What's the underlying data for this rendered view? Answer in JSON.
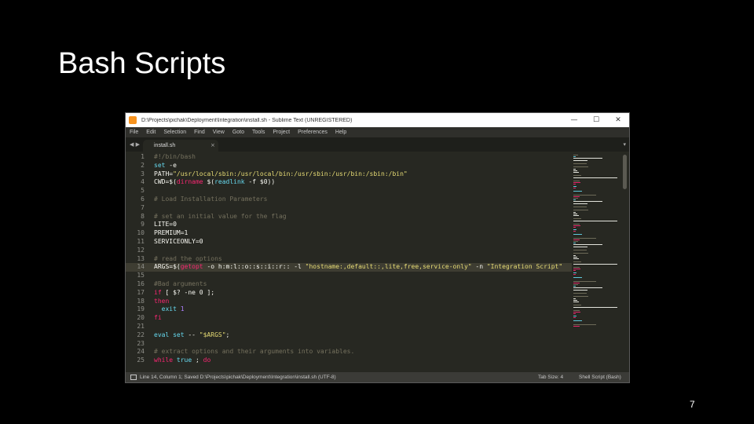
{
  "slide": {
    "title": "Bash Scripts",
    "page_number": "7"
  },
  "window": {
    "title": "D:\\Projects\\pichak\\Deployment\\Integration\\install.sh - Sublime Text (UNREGISTERED)",
    "buttons": [
      "—",
      "☐",
      "✕"
    ]
  },
  "menu": [
    "File",
    "Edit",
    "Selection",
    "Find",
    "View",
    "Goto",
    "Tools",
    "Project",
    "Preferences",
    "Help"
  ],
  "tabs": {
    "nav": "◀ ▶",
    "active_label": "install.sh",
    "close": "×",
    "dropdown": "▾"
  },
  "editor": {
    "highlighted_line": 14,
    "lines": [
      {
        "n": "1",
        "segments": [
          {
            "t": "#!/bin/bash",
            "c": "#75715e"
          }
        ]
      },
      {
        "n": "2",
        "segments": [
          {
            "t": "set",
            "c": "#66d9ef"
          },
          {
            "t": " -e",
            "c": "#f8f8f2"
          }
        ]
      },
      {
        "n": "3",
        "segments": [
          {
            "t": "PATH=",
            "c": "#f8f8f2"
          },
          {
            "t": "\"/usr/local/sbin:/usr/local/bin:/usr/sbin:/usr/bin:/sbin:/bin\"",
            "c": "#e6db74"
          }
        ]
      },
      {
        "n": "4",
        "segments": [
          {
            "t": "CWD=$(",
            "c": "#f8f8f2"
          },
          {
            "t": "dirname",
            "c": "#f92672"
          },
          {
            "t": " $(",
            "c": "#f8f8f2"
          },
          {
            "t": "readlink",
            "c": "#66d9ef"
          },
          {
            "t": " -f $0))",
            "c": "#f8f8f2"
          }
        ]
      },
      {
        "n": "5",
        "segments": []
      },
      {
        "n": "6",
        "segments": [
          {
            "t": "# Load Installation Parameters",
            "c": "#75715e"
          }
        ]
      },
      {
        "n": "7",
        "segments": []
      },
      {
        "n": "8",
        "segments": [
          {
            "t": "# set an initial value for the flag",
            "c": "#75715e"
          }
        ]
      },
      {
        "n": "9",
        "segments": [
          {
            "t": "LITE=0",
            "c": "#f8f8f2"
          }
        ]
      },
      {
        "n": "10",
        "segments": [
          {
            "t": "PREMIUM=1",
            "c": "#f8f8f2"
          }
        ]
      },
      {
        "n": "11",
        "segments": [
          {
            "t": "SERVICEONLY=0",
            "c": "#f8f8f2"
          }
        ]
      },
      {
        "n": "12",
        "segments": []
      },
      {
        "n": "13",
        "segments": [
          {
            "t": "# read the options",
            "c": "#75715e"
          }
        ]
      },
      {
        "n": "14",
        "segments": [
          {
            "t": "ARGS=$(",
            "c": "#f8f8f2"
          },
          {
            "t": "getopt",
            "c": "#f92672"
          },
          {
            "t": " -o h:m:l::o::s::i::r:: -l ",
            "c": "#f8f8f2"
          },
          {
            "t": "\"hostname:,default::,lite,free,service-only\"",
            "c": "#e6db74"
          },
          {
            "t": " -n ",
            "c": "#f8f8f2"
          },
          {
            "t": "\"Integration Script\"",
            "c": "#e6db74"
          }
        ]
      },
      {
        "n": "15",
        "segments": []
      },
      {
        "n": "16",
        "segments": [
          {
            "t": "#Bad arguments",
            "c": "#75715e"
          }
        ]
      },
      {
        "n": "17",
        "segments": [
          {
            "t": "if",
            "c": "#f92672"
          },
          {
            "t": " [ $? -ne 0 ];",
            "c": "#f8f8f2"
          }
        ]
      },
      {
        "n": "18",
        "segments": [
          {
            "t": "then",
            "c": "#f92672"
          }
        ]
      },
      {
        "n": "19",
        "segments": [
          {
            "t": "  exit",
            "c": "#66d9ef"
          },
          {
            "t": " 1",
            "c": "#ae81ff"
          }
        ]
      },
      {
        "n": "20",
        "segments": [
          {
            "t": "fi",
            "c": "#f92672"
          }
        ]
      },
      {
        "n": "21",
        "segments": []
      },
      {
        "n": "22",
        "segments": [
          {
            "t": "eval",
            "c": "#66d9ef"
          },
          {
            "t": " set",
            "c": "#66d9ef"
          },
          {
            "t": " -- ",
            "c": "#f8f8f2"
          },
          {
            "t": "\"$ARGS\"",
            "c": "#e6db74"
          },
          {
            "t": ";",
            "c": "#f8f8f2"
          }
        ]
      },
      {
        "n": "23",
        "segments": []
      },
      {
        "n": "24",
        "segments": [
          {
            "t": "# extract options and their arguments into variables.",
            "c": "#75715e"
          }
        ]
      },
      {
        "n": "25",
        "segments": [
          {
            "t": "while",
            "c": "#f92672"
          },
          {
            "t": " true",
            "c": "#66d9ef"
          },
          {
            "t": " ; ",
            "c": "#f8f8f2"
          },
          {
            "t": "do",
            "c": "#f92672"
          }
        ]
      }
    ]
  },
  "status": {
    "left": "Line 14, Column 1; Saved D:\\Projects\\pichak\\Deployment\\Integration\\install.sh (UTF-8)",
    "tab_size": "Tab Size: 4",
    "syntax": "Shell Script (Bash)"
  },
  "colors": {
    "background": "#000000",
    "editor_bg": "#272822",
    "accent": "#f7931e"
  }
}
